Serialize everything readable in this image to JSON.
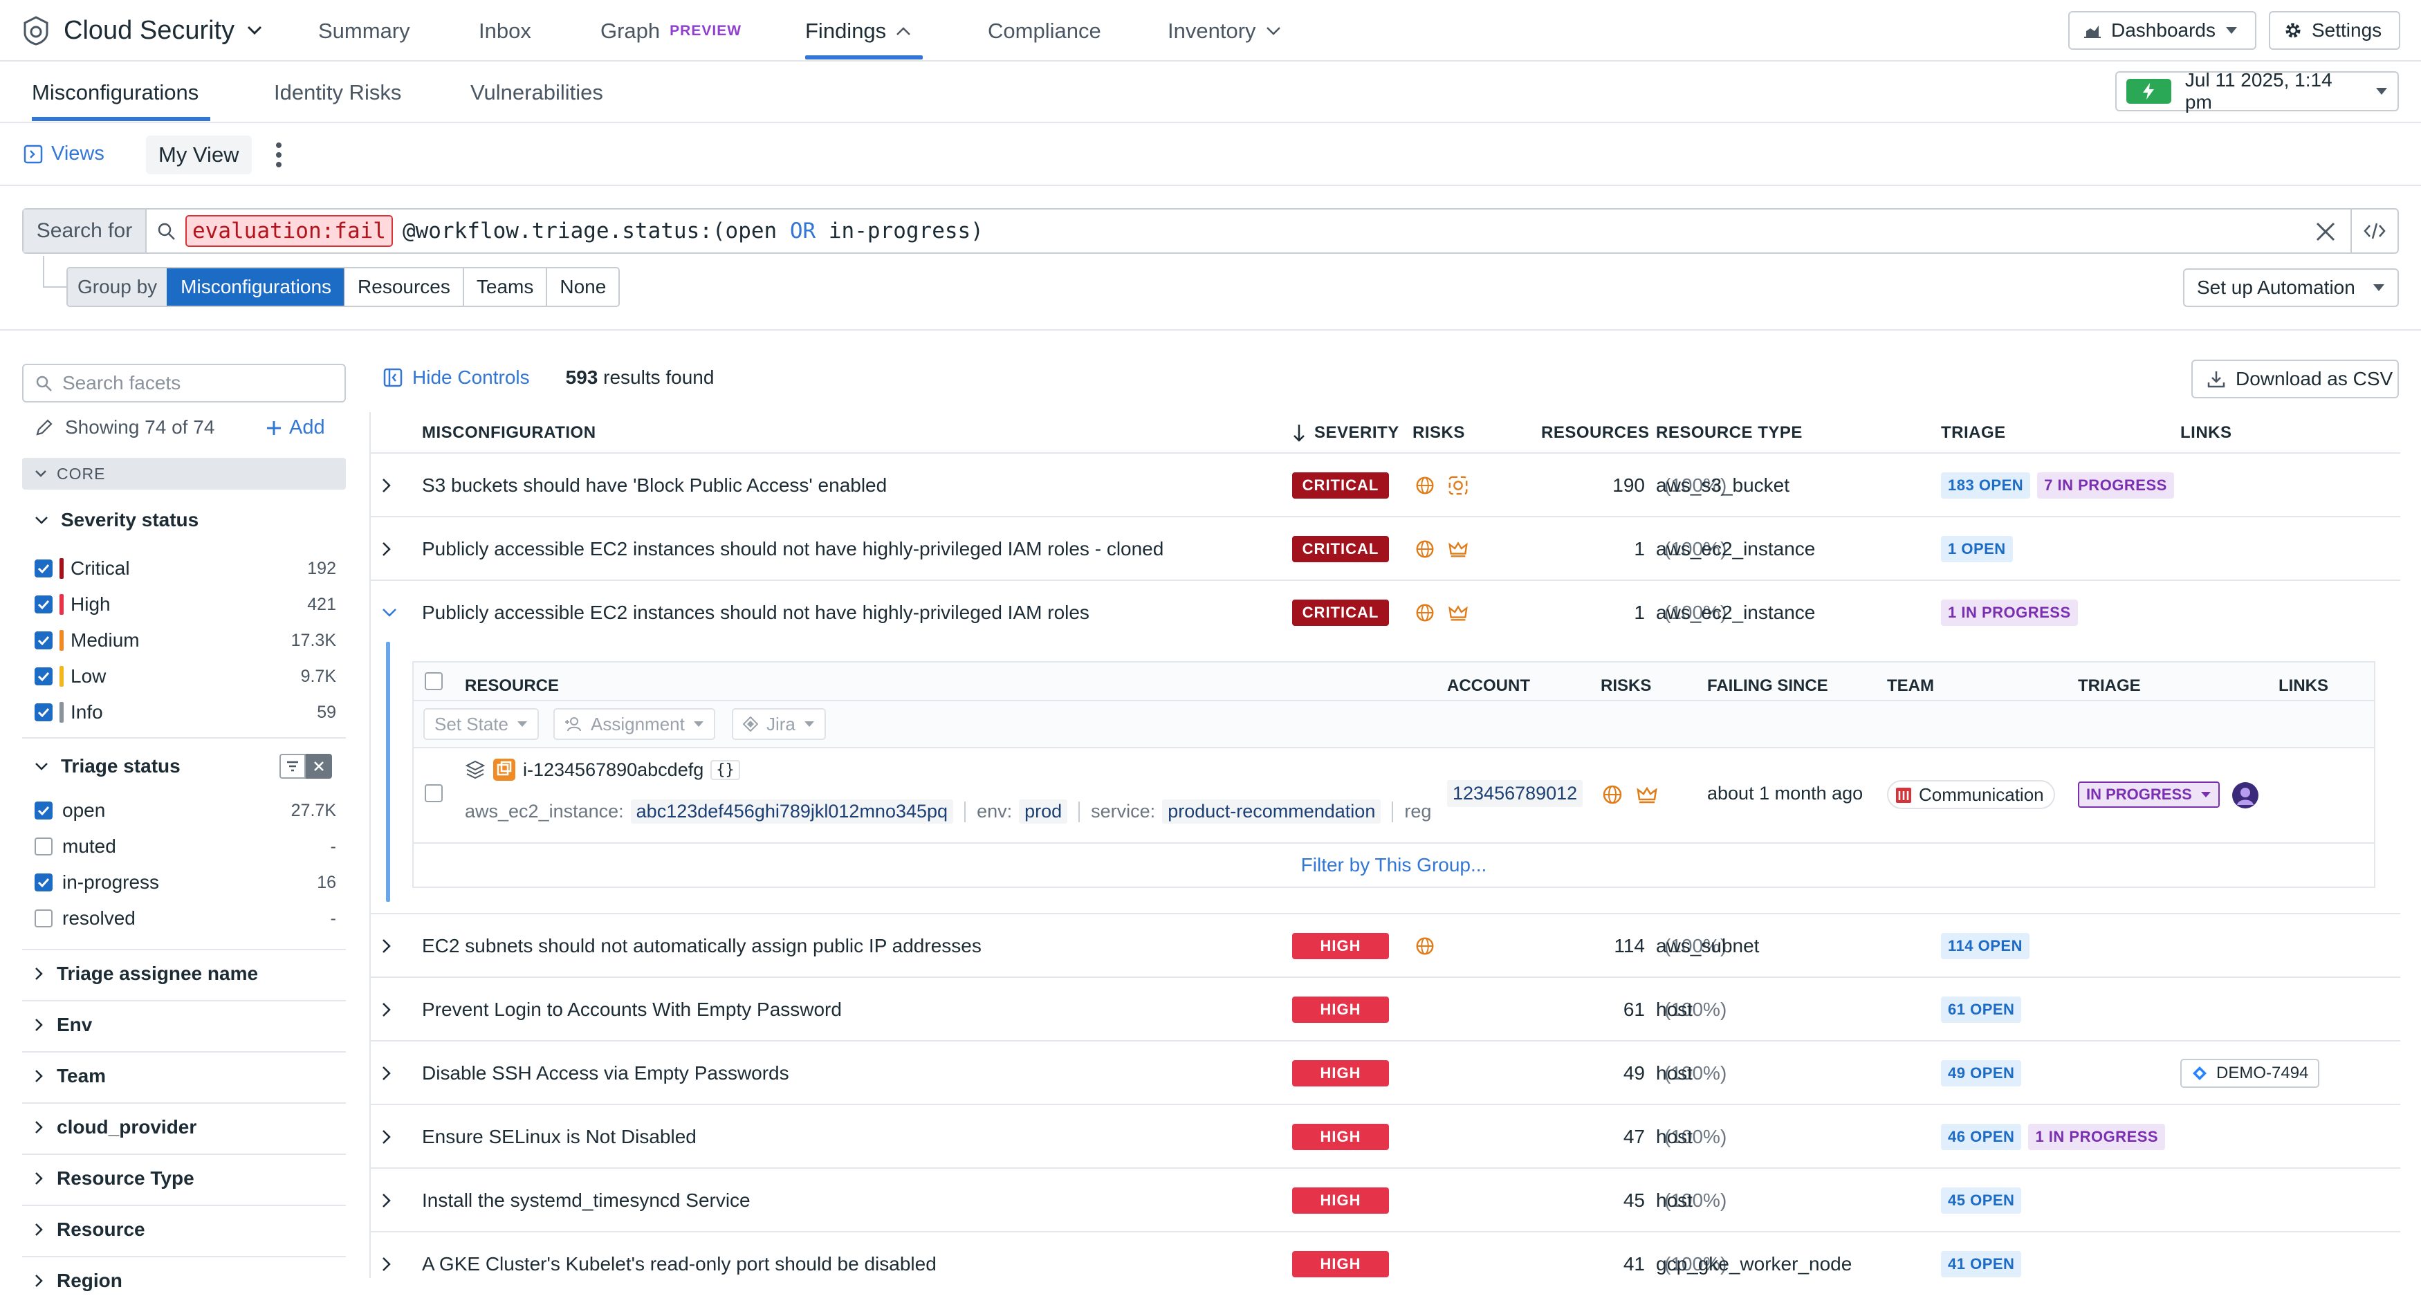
{
  "topnav": {
    "brand": "Cloud Security",
    "items": [
      {
        "label": "Summary"
      },
      {
        "label": "Inbox"
      },
      {
        "label": "Graph",
        "tag": "PREVIEW"
      },
      {
        "label": "Findings"
      },
      {
        "label": "Compliance"
      },
      {
        "label": "Inventory"
      }
    ],
    "dashboards": "Dashboards",
    "settings": "Settings"
  },
  "subnav": {
    "tabs": [
      "Misconfigurations",
      "Identity Risks",
      "Vulnerabilities"
    ],
    "time": "Jul 11 2025, 1:14 pm"
  },
  "views": {
    "views_label": "Views",
    "current": "My View"
  },
  "search": {
    "label": "Search for",
    "term_fail": "evaluation:fail",
    "term_rest_a": "@workflow.triage.status:(open ",
    "term_rest_op": "OR",
    "term_rest_b": " in-progress)"
  },
  "groupby": {
    "label": "Group by",
    "options": [
      "Misconfigurations",
      "Resources",
      "Teams",
      "None"
    ],
    "automation": "Set up Automation"
  },
  "facets": {
    "search_placeholder": "Search facets",
    "showing": "Showing 74 of 74",
    "add": "Add",
    "core": "CORE",
    "severity_title": "Severity status",
    "severity": [
      {
        "label": "Critical",
        "count": "192",
        "color": "#a1121d"
      },
      {
        "label": "High",
        "count": "421",
        "color": "#e5344a"
      },
      {
        "label": "Medium",
        "count": "17.3K",
        "color": "#f08a24"
      },
      {
        "label": "Low",
        "count": "9.7K",
        "color": "#f2b71c"
      },
      {
        "label": "Info",
        "count": "59",
        "color": "#8a939c"
      }
    ],
    "triage_title": "Triage status",
    "triage": [
      {
        "label": "open",
        "count": "27.7K",
        "checked": true
      },
      {
        "label": "muted",
        "count": "-",
        "checked": false
      },
      {
        "label": "in-progress",
        "count": "16",
        "checked": true
      },
      {
        "label": "resolved",
        "count": "-",
        "checked": false
      }
    ],
    "collapsed": [
      "Triage assignee name",
      "Env",
      "Team",
      "cloud_provider",
      "Resource Type",
      "Resource",
      "Region"
    ]
  },
  "results": {
    "hide_controls": "Hide Controls",
    "count": "593",
    "count_suffix": " results found",
    "csv": "Download as CSV"
  },
  "table": {
    "headers": {
      "misconfig": "MISCONFIGURATION",
      "severity": "SEVERITY",
      "risks": "RISKS",
      "resources": "RESOURCES",
      "resource_type": "RESOURCE TYPE",
      "triage": "TRIAGE",
      "links": "LINKS"
    },
    "rows": [
      {
        "name": "S3 buckets should have 'Block Public Access' enabled",
        "severity": "CRITICAL",
        "resources": "190",
        "pct": "(100%)",
        "type": "aws_s3_bucket",
        "open": "183 OPEN",
        "progress": "7 IN PROGRESS"
      },
      {
        "name": "Publicly accessible EC2 instances should not have highly-privileged IAM roles - cloned",
        "severity": "CRITICAL",
        "resources": "1",
        "pct": "(100%)",
        "type": "aws_ec2_instance",
        "open": "1 OPEN"
      },
      {
        "name": "Publicly accessible EC2 instances should not have highly-privileged IAM roles",
        "severity": "CRITICAL",
        "resources": "1",
        "pct": "(100%)",
        "type": "aws_ec2_instance",
        "progress": "1 IN PROGRESS"
      },
      {
        "name": "EC2 subnets should not automatically assign public IP addresses",
        "severity": "HIGH",
        "resources": "114",
        "pct": "(100%)",
        "type": "aws_subnet",
        "open": "114 OPEN"
      },
      {
        "name": "Prevent Login to Accounts With Empty Password",
        "severity": "HIGH",
        "resources": "61",
        "pct": "(100%)",
        "type": "host",
        "open": "61 OPEN"
      },
      {
        "name": "Disable SSH Access via Empty Passwords",
        "severity": "HIGH",
        "resources": "49",
        "pct": "(100%)",
        "type": "host",
        "open": "49 OPEN",
        "link": "DEMO-7494"
      },
      {
        "name": "Ensure SELinux is Not Disabled",
        "severity": "HIGH",
        "resources": "47",
        "pct": "(100%)",
        "type": "host",
        "open": "46 OPEN",
        "progress": "1 IN PROGRESS"
      },
      {
        "name": "Install the systemd_timesyncd Service",
        "severity": "HIGH",
        "resources": "45",
        "pct": "(100%)",
        "type": "host",
        "open": "45 OPEN"
      },
      {
        "name": "A GKE Cluster's Kubelet's read-only port should be disabled",
        "severity": "HIGH",
        "resources": "41",
        "pct": "(100%)",
        "type": "gcp_gke_worker_node",
        "open": "41 OPEN"
      }
    ]
  },
  "expanded": {
    "headers": {
      "resource": "RESOURCE",
      "account": "ACCOUNT",
      "risks": "RISKS",
      "failing": "FAILING SINCE",
      "team": "TEAM",
      "triage": "TRIAGE",
      "links": "LINKS"
    },
    "set_state": "Set State",
    "assignment": "Assignment",
    "jira": "Jira",
    "resource_id": "i-1234567890abcdefg",
    "json_icon": "{}",
    "tag1_k": "aws_ec2_instance:",
    "tag1_v": "abc123def456ghi789jkl012mno345pq",
    "tag2_k": "env:",
    "tag2_v": "prod",
    "tag3_k": "service:",
    "tag3_v": "product-recommendation",
    "tag4_k": "reg",
    "account": "123456789012",
    "failing": "about 1 month ago",
    "team": "Communication",
    "triage": "IN PROGRESS",
    "filter_group": "Filter by This Group..."
  }
}
